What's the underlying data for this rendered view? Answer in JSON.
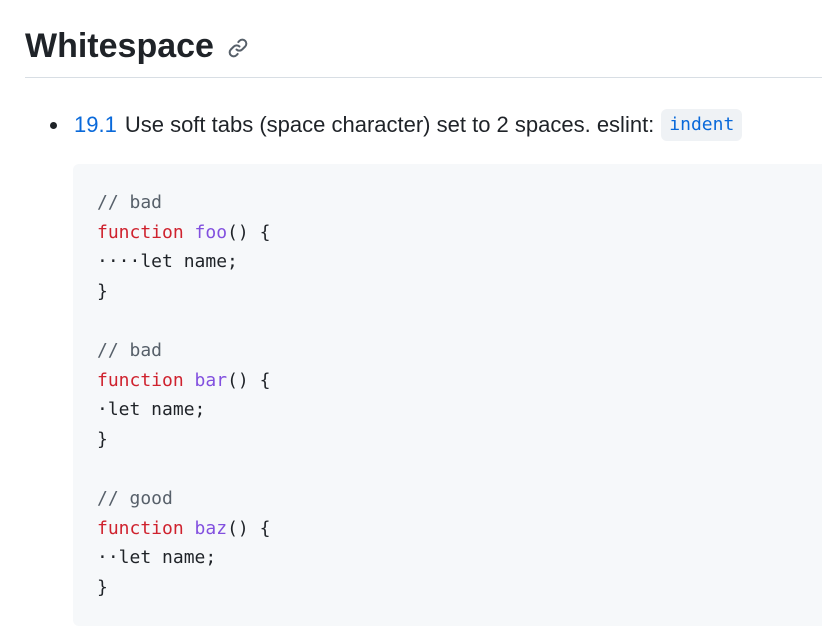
{
  "heading": {
    "title": "Whitespace",
    "anchor_icon": "link-icon"
  },
  "rule": {
    "number": "19.1",
    "text": "Use soft tabs (space character) set to 2 spaces. eslint:",
    "eslint_rule": "indent"
  },
  "code": {
    "blocks": [
      {
        "comment": "// bad",
        "keyword": "function",
        "fn_name": "foo",
        "signature": "() {",
        "body": "····let name;",
        "close": "}"
      },
      {
        "comment": "// bad",
        "keyword": "function",
        "fn_name": "bar",
        "signature": "() {",
        "body": "·let name;",
        "close": "}"
      },
      {
        "comment": "// good",
        "keyword": "function",
        "fn_name": "baz",
        "signature": "() {",
        "body": "··let name;",
        "close": "}"
      }
    ]
  },
  "colors": {
    "link": "#0969da",
    "comment": "#57606a",
    "keyword": "#cf222e",
    "function_name": "#8250df",
    "code_bg": "#f6f8fa"
  }
}
